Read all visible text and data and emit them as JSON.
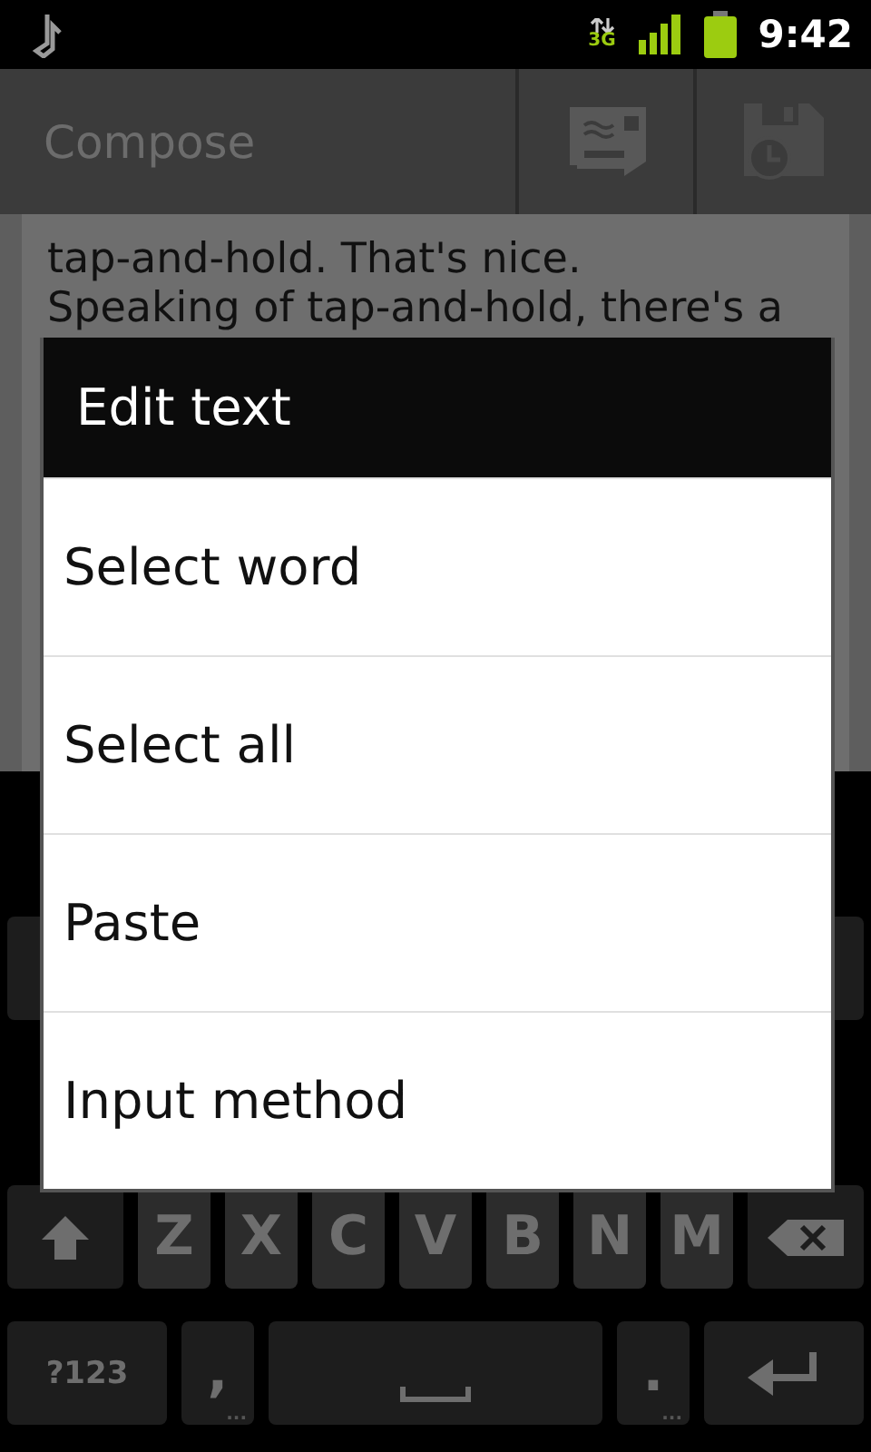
{
  "status_bar": {
    "network": "3G",
    "time": "9:42"
  },
  "action_bar": {
    "title": "Compose"
  },
  "message_body": {
    "lines": [
      "tap-and-hold. That's nice.",
      "Speaking of tap-and-hold, there's a"
    ]
  },
  "dialog": {
    "title": "Edit text",
    "items": [
      {
        "label": "Select word"
      },
      {
        "label": "Select all"
      },
      {
        "label": "Paste"
      },
      {
        "label": "Input method"
      }
    ]
  },
  "keyboard": {
    "rows": [
      [
        {
          "kind": "shift"
        },
        {
          "kind": "letter",
          "label": "Z"
        },
        {
          "kind": "letter",
          "label": "X"
        },
        {
          "kind": "letter",
          "label": "C"
        },
        {
          "kind": "letter",
          "label": "V"
        },
        {
          "kind": "letter",
          "label": "B"
        },
        {
          "kind": "letter",
          "label": "N"
        },
        {
          "kind": "letter",
          "label": "M"
        },
        {
          "kind": "backspace"
        }
      ],
      [
        {
          "kind": "symbols",
          "label": "?123"
        },
        {
          "kind": "punct",
          "label": ",",
          "hint": "..."
        },
        {
          "kind": "space"
        },
        {
          "kind": "punct",
          "label": ".",
          "hint": "..."
        },
        {
          "kind": "enter"
        }
      ]
    ]
  }
}
